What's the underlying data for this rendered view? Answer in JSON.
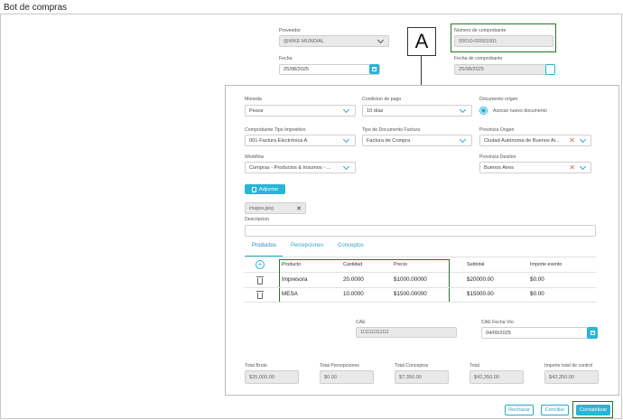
{
  "page": {
    "title": "Bot de compras"
  },
  "badge": {
    "letter": "A"
  },
  "header": {
    "proveedor": {
      "label": "Proveedor",
      "value": "@WKE MUNDIAL"
    },
    "numero": {
      "label": "Número de comprobante",
      "value": "00010-00001001"
    },
    "fecha": {
      "label": "Fecha",
      "value": "25/08/2025"
    },
    "fecha_comprobante": {
      "label": "Fecha de comprobante",
      "value": "25/08/2025"
    }
  },
  "form": {
    "moneda": {
      "label": "Moneda",
      "value": "Pesos"
    },
    "condicion": {
      "label": "Condicion de pago",
      "value": "10 días"
    },
    "documento_origen": {
      "label": "Documento origen",
      "radio_label": "Asociar nuevo documento"
    },
    "comprobante_tipo": {
      "label": "Comprobante Tipo Impositivo",
      "value": "001-Factura Electrónica A"
    },
    "tipo_documento": {
      "label": "Tipo de Documento Factura",
      "value": "Factura de Compra"
    },
    "provincia_origen": {
      "label": "Provincia Origen",
      "value": "Ciudad Autónoma de Buenos Ai..."
    },
    "workflow": {
      "label": "Workflow",
      "value": "Compras - Productos & Insumos - ..."
    },
    "provincia_destino": {
      "label": "Provincia Destino",
      "value": "Buenos Aires"
    },
    "adjuntar_label": "Adjuntar",
    "attachment": "images.jpeg",
    "descripcion": {
      "label": "Descripcion",
      "value": ""
    }
  },
  "tabs": [
    {
      "label": "Productos"
    },
    {
      "label": "Percepciones"
    },
    {
      "label": "Conceptos"
    }
  ],
  "table": {
    "headers": [
      "Producto",
      "Cantidad",
      "Precio",
      "Subtotal",
      "Importe exento"
    ],
    "rows": [
      {
        "producto": "Impresora",
        "cantidad": "20.0000",
        "precio": "$1000.00000",
        "subtotal": "$20000.00",
        "exento": "$0.00"
      },
      {
        "producto": "MESA",
        "cantidad": "10.0000",
        "precio": "$1500.00000",
        "subtotal": "$15000.00",
        "exento": "$0.00"
      }
    ]
  },
  "cae": {
    "label": "CAE",
    "value": "1111111111111"
  },
  "cae_fecha": {
    "label": "CAE Fecha Vto",
    "value": "04/09/2025"
  },
  "totals": [
    {
      "label": "Total Bruto",
      "value": "$35,000.00"
    },
    {
      "label": "Total Percepciones",
      "value": "$0.00"
    },
    {
      "label": "Total Conceptos",
      "value": "$7,350.00"
    },
    {
      "label": "Total",
      "value": "$42,350.00"
    },
    {
      "label": "Importe total de control",
      "value": "$42,350.00"
    }
  ],
  "actions": {
    "rechazar": "Rechazar",
    "conciliar": "Conciliar",
    "contabilizar": "Contabilizar"
  },
  "colors": {
    "accent": "#29b4d8",
    "highlight": "#1f7a1f"
  }
}
